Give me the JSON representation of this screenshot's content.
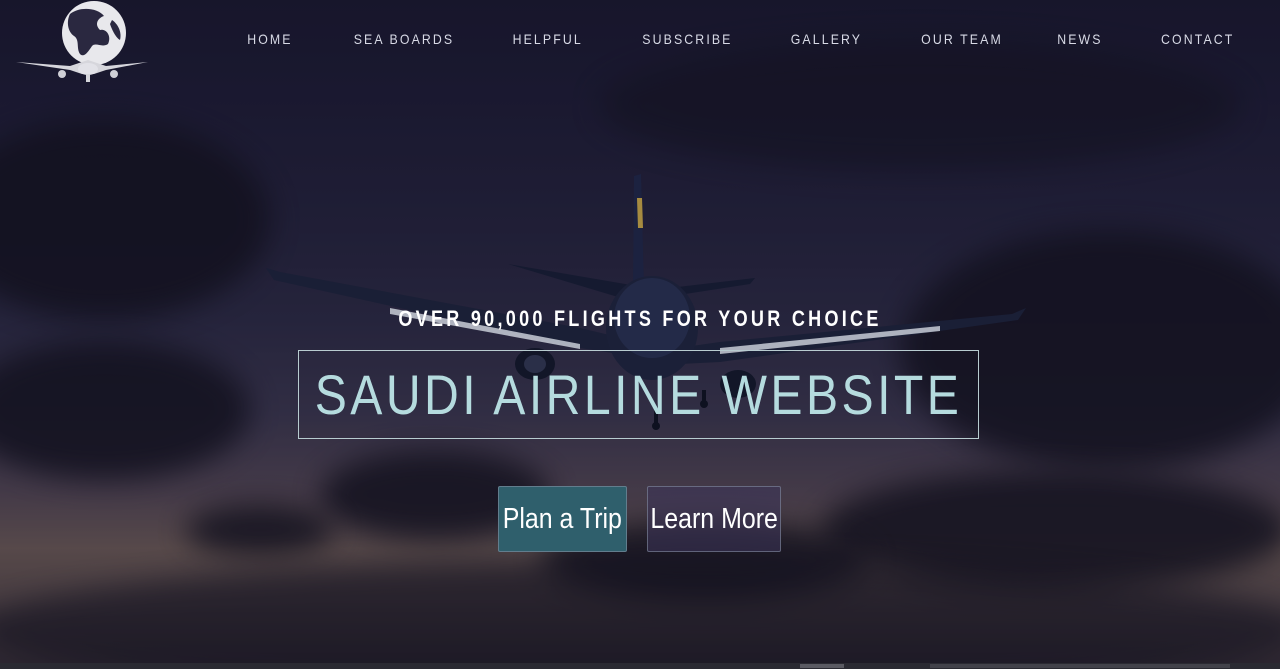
{
  "nav": {
    "items": [
      {
        "label": "HOME"
      },
      {
        "label": "SEA BOARDS"
      },
      {
        "label": "HELPFUL"
      },
      {
        "label": "SUBSCRIBE"
      },
      {
        "label": "GALLERY"
      },
      {
        "label": "OUR TEAM"
      },
      {
        "label": "NEWS"
      },
      {
        "label": "CONTACT"
      }
    ]
  },
  "hero": {
    "tagline": "OVER 90,000 FLIGHTS FOR YOUR CHOICE",
    "title": "SAUDI AIRLINE WEBSITE",
    "buttons": {
      "plan": "Plan a Trip",
      "learn": "Learn More"
    }
  },
  "icons": {
    "logo": "globe-airplane-logo"
  },
  "colors": {
    "title": "#b5dbde",
    "plan_button": "#2f5f6c",
    "learn_button": "#3c345a",
    "sky": "#1f1d36"
  }
}
